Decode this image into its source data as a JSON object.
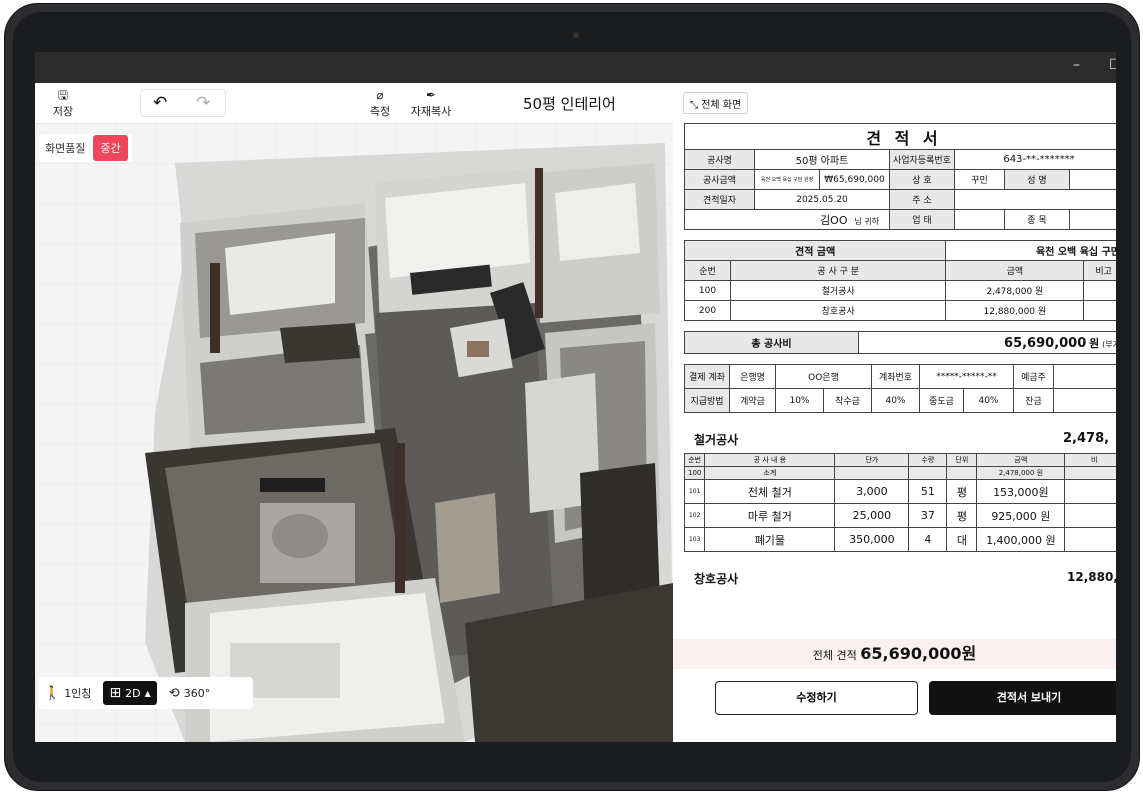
{
  "toolbar": {
    "save_label": "저장",
    "measure_label": "측정",
    "copy_material_label": "자재복사",
    "project_title": "50평 인테리어"
  },
  "quality": {
    "label": "화면품질",
    "value": "중간"
  },
  "viewbar": {
    "first_person": "1인칭",
    "mode_2d": "2D",
    "view_360": "360°"
  },
  "panel": {
    "fullscreen_label": "전체 화면"
  },
  "estimate": {
    "title": "견 적 서",
    "project_name_label": "공사명",
    "project_name": "50평 아파트",
    "biz_reg_label": "사업자등록번호",
    "biz_reg_value": "643-**-*******",
    "amount_label": "공사금액",
    "amount_small": "육천 오백 육십 구만 원정",
    "amount_value": "₩65,690,000",
    "company_label": "상 호",
    "company_value": "꾸민",
    "name_label": "성 명",
    "date_label": "견적일자",
    "date_value": "2025.05.20",
    "address_label": "주 소",
    "customer_name": "김OO",
    "customer_suffix": "님 귀하",
    "business_type_label": "업 태",
    "item_label": "종 목",
    "summary_label": "견적 금액",
    "summary_text": "육천 오백 육십 구만",
    "summary_cols": [
      "순번",
      "공 사 구 분",
      "금액",
      "비고"
    ],
    "summary_rows": [
      [
        "100",
        "철거공사",
        "2,478,000 원",
        ""
      ],
      [
        "200",
        "창호공사",
        "12,880,000 원",
        ""
      ]
    ],
    "total_label": "총 공사비",
    "total_value": "65,690,000",
    "total_unit": "원",
    "total_note": "(부가",
    "payment": {
      "account_label": "결제 계좌",
      "bank_label": "은행명",
      "bank_value": "OO은행",
      "account_no_label": "계좌번호",
      "account_no_value": "*****-*****-**",
      "holder_label": "예금주",
      "method_label": "지급방법",
      "contract_label": "계약금",
      "contract_value": "10%",
      "start_label": "착수금",
      "start_value": "40%",
      "mid_label": "중도금",
      "mid_value": "40%",
      "balance_label": "잔금"
    },
    "section1_title": "철거공사",
    "section1_total": "2,478,",
    "detail_cols": [
      "순번",
      "공 사 내 용",
      "단가",
      "수량",
      "단위",
      "금액",
      "비"
    ],
    "section1_subtotal": [
      "100",
      "소계",
      "",
      "",
      "",
      "2,478,000 원",
      ""
    ],
    "section1_rows": [
      [
        "101",
        "전체 철거",
        "3,000",
        "51",
        "평",
        "153,000원",
        ""
      ],
      [
        "102",
        "마루 철거",
        "25,000",
        "37",
        "평",
        "925,000 원",
        ""
      ],
      [
        "103",
        "폐기물",
        "350,000",
        "4",
        "대",
        "1,400,000 원",
        ""
      ]
    ],
    "section2_title": "창호공사",
    "section2_total": "12,880,"
  },
  "footer": {
    "total_prefix": "전체 견적",
    "total_amount": "65,690,000원",
    "edit_label": "수정하기",
    "send_label": "견적서 보내기"
  },
  "colors": {
    "accent": "#f0465c",
    "dark": "#111111"
  }
}
